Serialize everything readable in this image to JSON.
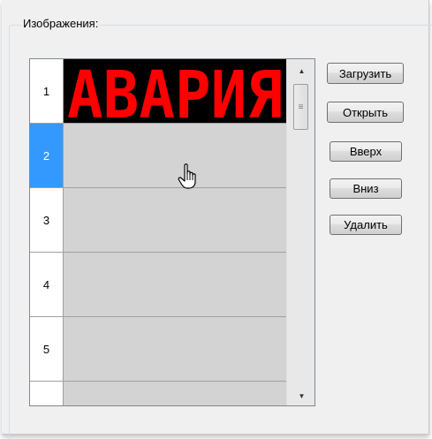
{
  "group": {
    "title": "Изображения:"
  },
  "grid": {
    "selected_row": 2,
    "rows": [
      {
        "number": "1",
        "image_text": "АВАРИЯ"
      },
      {
        "number": "2"
      },
      {
        "number": "3"
      },
      {
        "number": "4"
      },
      {
        "number": "5"
      }
    ]
  },
  "buttons": {
    "load": "Загрузить",
    "open": "Открыть",
    "up": "Вверх",
    "down": "Вниз",
    "delete": "Удалить"
  },
  "colors": {
    "selection": "#3399ff",
    "led_text": "#ff0000",
    "led_background": "#000000"
  },
  "icons": [
    "scroll-up-icon",
    "scroll-down-icon",
    "scroll-grip-icon",
    "hand-pointer-icon"
  ]
}
